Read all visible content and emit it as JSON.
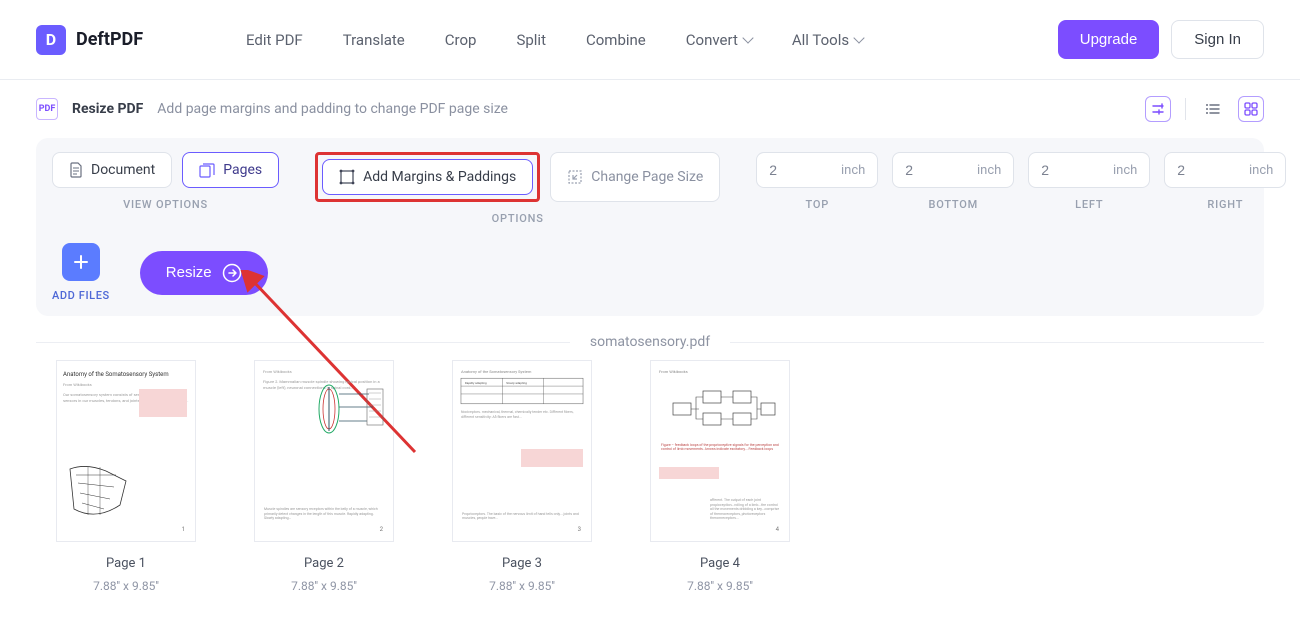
{
  "header": {
    "brand": "DeftPDF",
    "nav": [
      "Edit PDF",
      "Translate",
      "Crop",
      "Split",
      "Combine",
      "Convert",
      "All Tools"
    ],
    "upgrade": "Upgrade",
    "signin": "Sign In"
  },
  "page": {
    "title": "Resize PDF",
    "subtitle": "Add page margins and padding to change PDF page size",
    "icon_label": "PDF"
  },
  "view_options": {
    "document": "Document",
    "pages": "Pages",
    "label": "VIEW OPTIONS"
  },
  "options": {
    "add_margins": "Add Margins & Paddings",
    "change_size": "Change Page Size",
    "label": "OPTIONS"
  },
  "margins": {
    "unit": "inch",
    "sides": [
      {
        "label": "TOP",
        "value": "2"
      },
      {
        "label": "BOTTOM",
        "value": "2"
      },
      {
        "label": "LEFT",
        "value": "2"
      },
      {
        "label": "RIGHT",
        "value": "2"
      }
    ]
  },
  "actions": {
    "add_files": "ADD FILES",
    "resize": "Resize"
  },
  "file": {
    "name": "somatosensory.pdf"
  },
  "thumbs": [
    {
      "label": "Page 1",
      "dim": "7.88'' x 9.85''",
      "num": "1",
      "heading": "Anatomy of the Somatosensory System"
    },
    {
      "label": "Page 2",
      "dim": "7.88'' x 9.85''",
      "num": "2"
    },
    {
      "label": "Page 3",
      "dim": "7.88'' x 9.85''",
      "num": "3"
    },
    {
      "label": "Page 4",
      "dim": "7.88'' x 9.85''",
      "num": "4"
    }
  ]
}
